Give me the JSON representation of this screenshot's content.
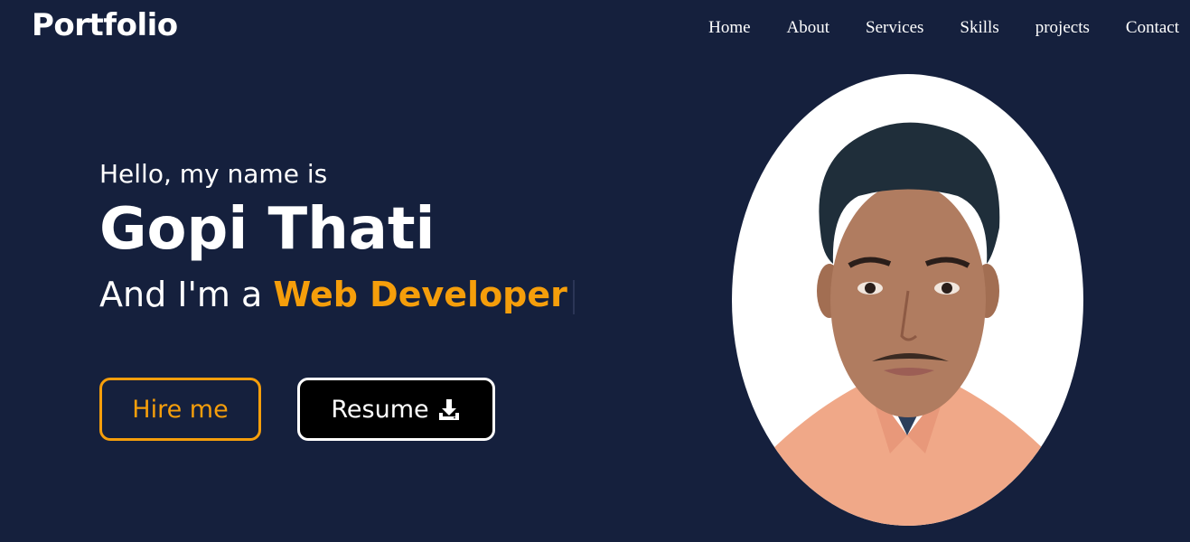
{
  "header": {
    "logo": "Portfolio",
    "nav": [
      "Home",
      "About",
      "Services",
      "Skills",
      "projects",
      "Contact"
    ]
  },
  "hero": {
    "greeting": "Hello, my name is",
    "name": "Gopi Thati",
    "role_prefix": "And I'm a",
    "role": "Web Developer",
    "hire_button": "Hire me",
    "resume_button": "Resume",
    "resume_icon": "download-icon"
  },
  "colors": {
    "background": "#15203d",
    "accent": "#f59e0b",
    "text": "#ffffff"
  }
}
